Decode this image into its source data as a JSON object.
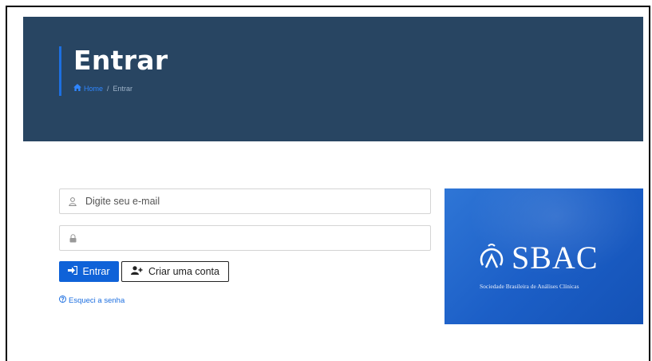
{
  "header": {
    "title": "Entrar",
    "breadcrumb": {
      "home_label": "Home",
      "separator": "/",
      "current": "Entrar"
    },
    "background_color": "#284562",
    "accent_color": "#1d6fe0"
  },
  "login_form": {
    "email": {
      "placeholder": "Digite seu e-mail",
      "value": ""
    },
    "password": {
      "placeholder": "",
      "value": ""
    },
    "submit_label": "Entrar",
    "create_account_label": "Criar uma conta",
    "forgot_password_label": "Esqueci a senha",
    "primary_color": "#0f62d8"
  },
  "brand_panel": {
    "logo_text": "SBAC",
    "logo_subtitle": "Sociedade Brasileira de Análises Clínicas",
    "background_color": "#1c5fc7"
  },
  "icons": {
    "breadcrumb_home": "home-icon",
    "email_field": "user-icon",
    "password_field": "lock-icon",
    "submit": "sign-in-icon",
    "create_account": "user-plus-icon",
    "forgot": "question-circle-icon"
  }
}
